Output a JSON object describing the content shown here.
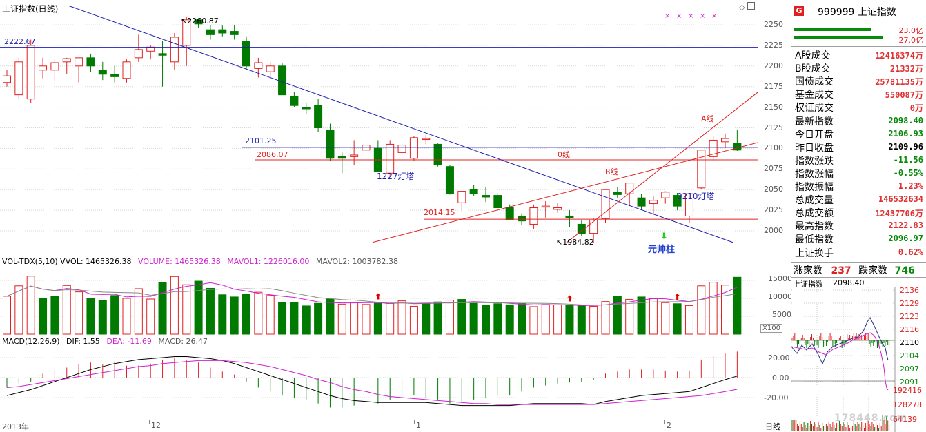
{
  "main_chart": {
    "title": "上证指数(日线)",
    "y_ticks": [
      "2250",
      "2225",
      "2200",
      "2175",
      "2150",
      "2125",
      "2100",
      "2075",
      "2050",
      "2025",
      "2000"
    ],
    "annotations": {
      "high_label": "2260.87",
      "low_label": "1984.82",
      "line_2222": "2222.67",
      "line_2101": "2101.25",
      "line_2086": "2086.07",
      "line_2014": "2014.15",
      "tower_1227": "1227灯塔",
      "tower_0210": "0210灯塔",
      "line_a": "A线",
      "line_b": "B线",
      "line_0": "0线",
      "marshal": "元帅柱"
    }
  },
  "volume_panel": {
    "header_prefix": "VOL-TDX(5,10) VVOL: 1465326.38",
    "volume": "VOLUME: 1465326.38",
    "mavol1": "MAVOL1: 1226016.00",
    "mavol2": "MAVOL2: 1003782.38",
    "y_ticks": [
      "15000",
      "10000",
      "5000"
    ],
    "unit": "X100"
  },
  "macd_panel": {
    "header_prefix": "MACD(12,26,9)",
    "dif": "DIF: 1.55",
    "dea": "DEA: -11.69",
    "macd": "MACD: 26.47",
    "y_ticks": [
      "20.00",
      "0.00",
      "-20.00"
    ]
  },
  "x_axis": {
    "labels": [
      "2013年",
      "12",
      "1",
      "2"
    ],
    "period": "日线"
  },
  "info_panel": {
    "badge": "G",
    "code_name": "999999 上证指数",
    "bar_values": [
      "23.0亿",
      "27.0亿"
    ],
    "rows": [
      {
        "k": "A股成交",
        "v": "12416374万",
        "c": "red"
      },
      {
        "k": "B股成交",
        "v": "21332万",
        "c": "red"
      },
      {
        "k": "国债成交",
        "v": "25781135万",
        "c": "red"
      },
      {
        "k": "基金成交",
        "v": "550087万",
        "c": "red"
      },
      {
        "k": "权证成交",
        "v": "0万",
        "c": "red"
      },
      {
        "k": "最新指数",
        "v": "2098.40",
        "c": "green"
      },
      {
        "k": "今日开盘",
        "v": "2106.93",
        "c": "green"
      },
      {
        "k": "昨日收盘",
        "v": "2109.96",
        "c": "blk"
      },
      {
        "k": "指数涨跌",
        "v": "-11.56",
        "c": "green"
      },
      {
        "k": "指数涨幅",
        "v": "-0.55%",
        "c": "green"
      },
      {
        "k": "指数振幅",
        "v": "1.23%",
        "c": "red"
      },
      {
        "k": "总成交量",
        "v": "146532634",
        "c": "red"
      },
      {
        "k": "总成交额",
        "v": "12437706万",
        "c": "red"
      },
      {
        "k": "最高指数",
        "v": "2122.83",
        "c": "red"
      },
      {
        "k": "最低指数",
        "v": "2096.97",
        "c": "green"
      },
      {
        "k": "上证换手",
        "v": "0.62%",
        "c": "red"
      }
    ],
    "advance_label": "涨家数",
    "advance_value": "237",
    "decline_label": "跌家数",
    "decline_value": "746"
  },
  "mini_chart": {
    "title": "上证指数",
    "value": "2098.40",
    "y_ticks": [
      "2136",
      "2129",
      "2123",
      "2116",
      "2110",
      "2104",
      "2097",
      "2091"
    ],
    "vol_ticks": [
      "192416",
      "128278",
      "64139"
    ],
    "watermark": "178448.com"
  },
  "colors": {
    "up": "#e02020",
    "down": "#007a00",
    "blue_line": "#2020b0",
    "purple": "#d020d0"
  }
}
